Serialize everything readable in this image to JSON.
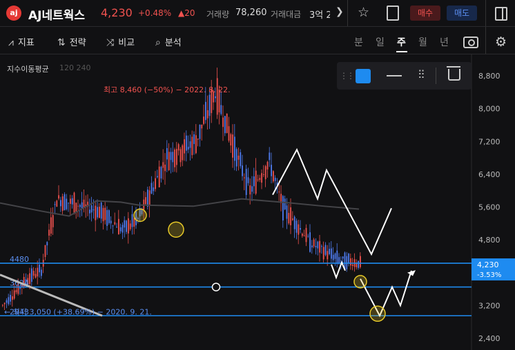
{
  "header": {
    "logo_text": "aj",
    "stock_name": "AJ네트웍스",
    "price": "4,230",
    "change_pct": "+0.48%",
    "change_abs": "▲20",
    "volume_label": "거래량",
    "volume": "78,260",
    "amount_label": "거래대금",
    "amount": "3억 2",
    "buy_label": "매수",
    "sell_label": "매도",
    "icons": [
      "chevron-right-icon",
      "star-icon",
      "clipboard-icon",
      "panel-icon"
    ]
  },
  "toolbar": {
    "indicator_label": "지표",
    "strategy_label": "전략",
    "compare_label": "비교",
    "analysis_label": "분석",
    "periods": [
      "분",
      "일",
      "주",
      "월",
      "년"
    ],
    "active_period": "주",
    "icons": [
      "indicator-icon",
      "strategy-icon",
      "compare-icon",
      "analysis-icon",
      "camera-icon",
      "gear-icon"
    ]
  },
  "overlay": {
    "ma_label": "지수이동평균",
    "ma_params": "120 240"
  },
  "drawing_toolbar": {
    "color": "#1e8bf0",
    "icons": [
      "drag-handle-icon",
      "color-square-icon",
      "line-style-icon",
      "sliders-icon",
      "trash-icon"
    ]
  },
  "chart_data": {
    "type": "candlestick",
    "interval": "weekly",
    "yaxis_ticks": [
      8800,
      8000,
      7200,
      6400,
      5600,
      4800,
      4000,
      3200,
      2400
    ],
    "yaxis_tick_labels": [
      "8,800",
      "8,000",
      "7,200",
      "6,400",
      "5,600",
      "4,800",
      "",
      "3,200",
      "2,400"
    ],
    "ylim": [
      2300,
      9100
    ],
    "current_price": {
      "value": 4230,
      "label": "4,230",
      "pct_label": "-3.53%"
    },
    "annotations": [
      {
        "type": "high",
        "text": "최고 8,460 (−50%) − 2022. 8. 22.",
        "value": 8460,
        "color": "#f0524f"
      },
      {
        "type": "low",
        "text": "← 최저 3,050 (+38.69%) − 2020. 9. 21.",
        "value": 3050,
        "color": "#5b8ff0"
      }
    ],
    "horizontal_lines": [
      {
        "value": 4230,
        "label": "4480",
        "color": "#1e8bf0"
      },
      {
        "value": 3650,
        "label": "3624",
        "color": "#1e8bf0"
      },
      {
        "value": 2950,
        "label": "2943",
        "color": "#1e8bf0"
      }
    ],
    "up_color": "#f0524f",
    "down_color": "#4f7cf0",
    "ma_color": "#444448",
    "grid": false
  }
}
